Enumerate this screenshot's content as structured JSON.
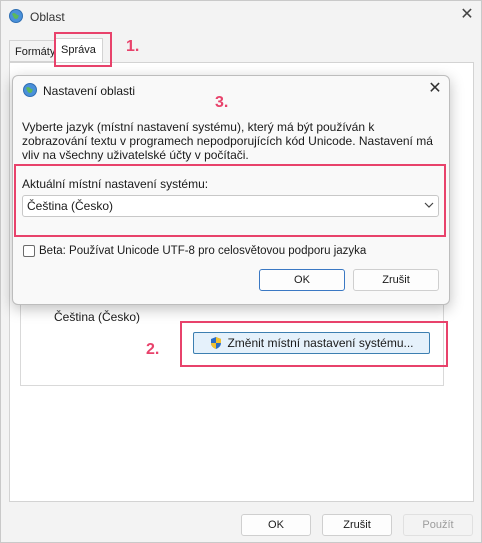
{
  "outer_window": {
    "title": "Oblast",
    "tabs": [
      {
        "label": "Formáty"
      },
      {
        "label": "Správa"
      }
    ],
    "current_locale": "Čeština (Česko)",
    "change_button_label": "Změnit místní nastavení systému...",
    "buttons": {
      "ok": "OK",
      "cancel": "Zrušit",
      "apply": "Použít"
    }
  },
  "dialog": {
    "title": "Nastavení oblasti",
    "description": "Vyberte jazyk (místní nastavení systému), který má být používán k zobrazování textu v programech nepodporujících kód Unicode. Nastavení má vliv na všechny uživatelské účty v počítači.",
    "locale_label": "Aktuální místní nastavení systému:",
    "locale_value": "Čeština (Česko)",
    "beta_label": "Beta: Používat Unicode UTF-8 pro celosvětovou podporu jazyka",
    "beta_checked": false,
    "buttons": {
      "ok": "OK",
      "cancel": "Zrušit"
    }
  },
  "annotations": {
    "step1": "1.",
    "step2": "2.",
    "step3": "3.",
    "color": "#e8426b"
  },
  "icons": {
    "window": "globe-icon",
    "close": "close-icon",
    "shield": "shield-icon",
    "dropdown": "chevron-down-icon"
  }
}
